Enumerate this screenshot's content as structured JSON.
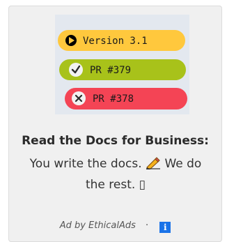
{
  "ad": {
    "image": {
      "badges": [
        {
          "label": "Version 3.1",
          "icon": "play-icon",
          "color": "#ffc83d"
        },
        {
          "label": "PR #379",
          "icon": "check-icon",
          "color": "#a8c21a"
        },
        {
          "label": "PR #378",
          "icon": "close-icon",
          "color": "#f44455"
        }
      ],
      "background_color": "#e3e8ef"
    },
    "title": "Read the Docs for Business:",
    "body_part1": "You write the docs.",
    "body_icon": "pencil-icon",
    "body_part2": "We do the rest.",
    "body_trailing_glyph": "▯",
    "attribution": "Ad by EthicalAds",
    "separator": "·",
    "info_icon_label": "i",
    "info_icon_color": "#1a73e8"
  }
}
